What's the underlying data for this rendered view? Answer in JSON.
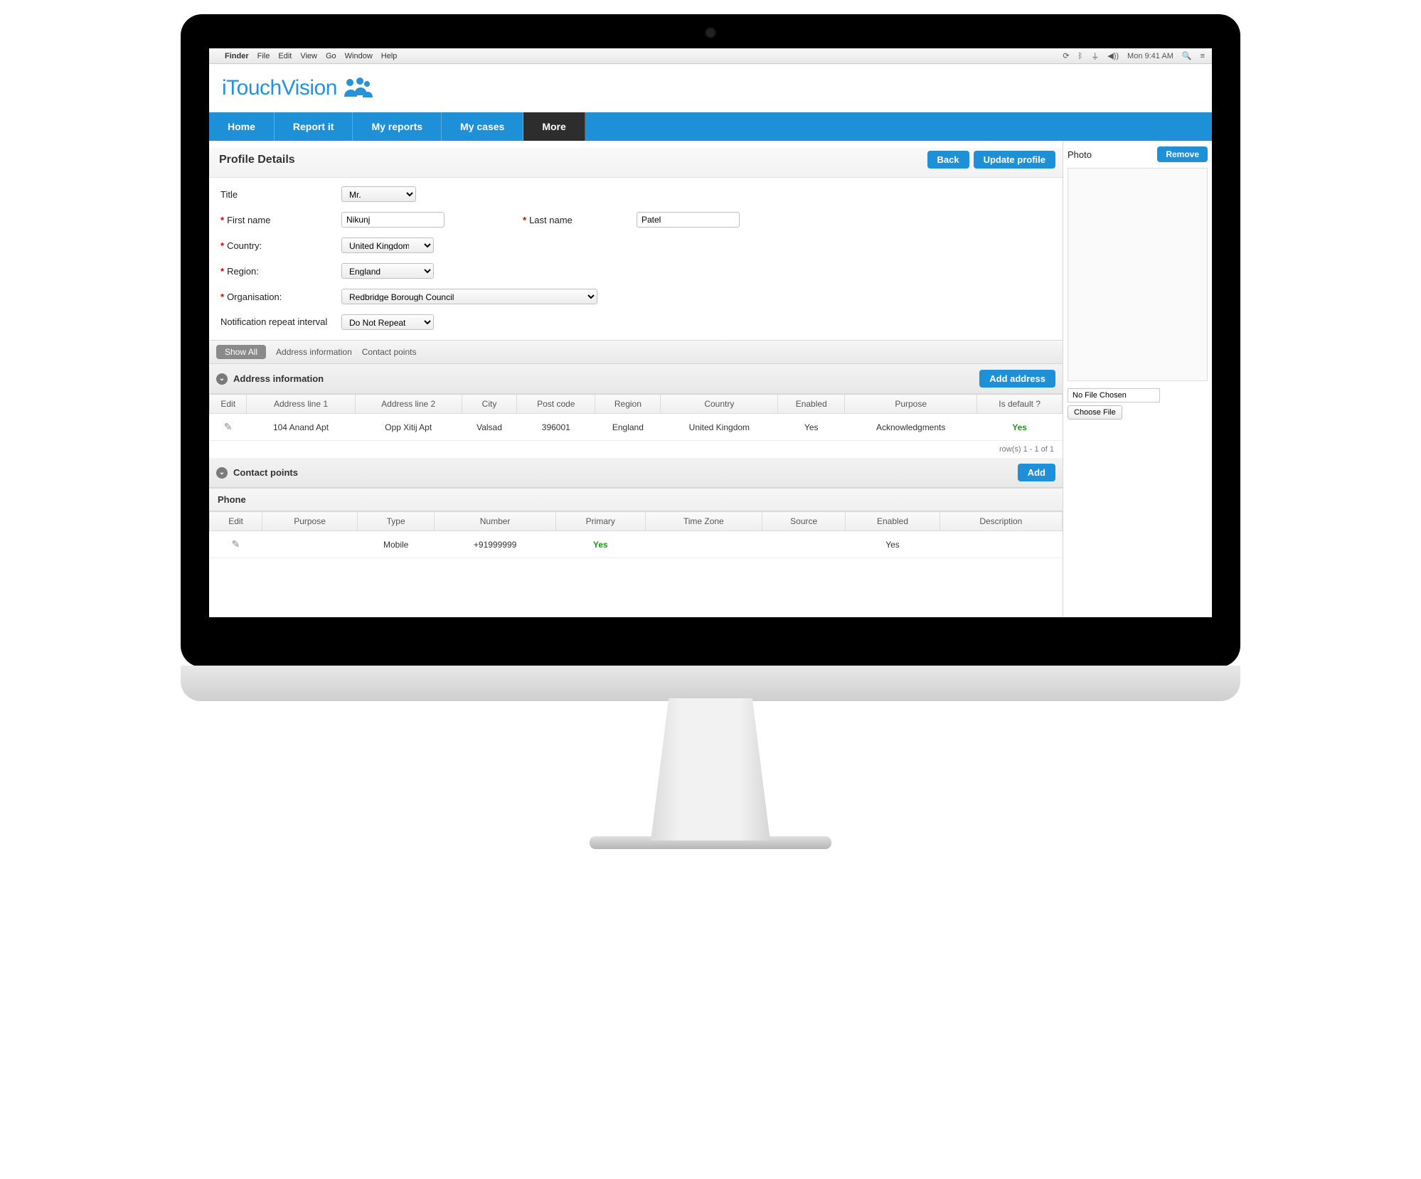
{
  "menubar": {
    "app": "Finder",
    "items": [
      "File",
      "Edit",
      "View",
      "Go",
      "Window",
      "Help"
    ],
    "clock": "Mon 9:41 AM"
  },
  "brand": "iTouchVision",
  "nav": {
    "items": [
      "Home",
      "Report it",
      "My reports",
      "My cases",
      "More"
    ],
    "active": "More"
  },
  "page": {
    "title": "Profile Details",
    "back": "Back",
    "update": "Update profile"
  },
  "form": {
    "title_label": "Title",
    "title_value": "Mr.",
    "first_name_label": "First name",
    "first_name_value": "Nikunj",
    "last_name_label": "Last name",
    "last_name_value": "Patel",
    "country_label": "Country:",
    "country_value": "United Kingdom",
    "region_label": "Region:",
    "region_value": "England",
    "organisation_label": "Organisation:",
    "organisation_value": "Redbridge Borough Council",
    "notification_label": "Notification repeat interval",
    "notification_value": "Do Not Repeat"
  },
  "tabs": {
    "show_all": "Show All",
    "addr": "Address information",
    "contact": "Contact points"
  },
  "address_section": {
    "title": "Address information",
    "add_btn": "Add address",
    "columns": [
      "Edit",
      "Address line 1",
      "Address line 2",
      "City",
      "Post code",
      "Region",
      "Country",
      "Enabled",
      "Purpose",
      "Is default ?"
    ],
    "row": {
      "line1": "104 Anand Apt",
      "line2": "Opp Xitij Apt",
      "city": "Valsad",
      "postcode": "396001",
      "region": "England",
      "country": "United Kingdom",
      "enabled": "Yes",
      "purpose": "Acknowledgments",
      "default": "Yes"
    },
    "row_count": "row(s) 1 - 1 of 1"
  },
  "contact_section": {
    "title": "Contact points",
    "add_btn": "Add",
    "subtitle": "Phone",
    "columns": [
      "Edit",
      "Purpose",
      "Type",
      "Number",
      "Primary",
      "Time Zone",
      "Source",
      "Enabled",
      "Description"
    ],
    "row": {
      "type": "Mobile",
      "number": "+91999999",
      "primary": "Yes",
      "enabled": "Yes"
    }
  },
  "sidebar": {
    "photo_label": "Photo",
    "remove_btn": "Remove",
    "file_status": "No File Chosen",
    "choose_btn": "Choose File"
  }
}
